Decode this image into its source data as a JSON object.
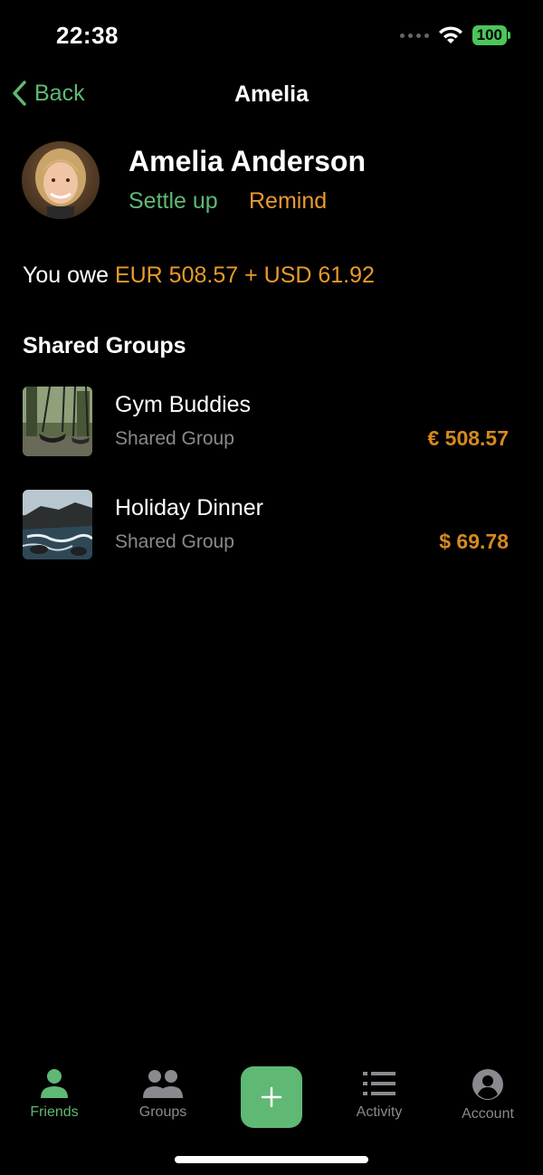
{
  "status_bar": {
    "time": "22:38",
    "battery": "100"
  },
  "nav": {
    "back_label": "Back",
    "title": "Amelia"
  },
  "profile": {
    "name": "Amelia Anderson",
    "settle_label": "Settle up",
    "remind_label": "Remind"
  },
  "balance": {
    "prefix": "You owe",
    "amount": "EUR 508.57 + USD 61.92"
  },
  "shared_groups": {
    "title": "Shared Groups",
    "items": [
      {
        "name": "Gym Buddies",
        "subtitle": "Shared Group",
        "amount": "€ 508.57"
      },
      {
        "name": "Holiday Dinner",
        "subtitle": "Shared Group",
        "amount": "$ 69.78"
      }
    ]
  },
  "tabbar": {
    "items": [
      {
        "label": "Friends",
        "icon": "person-icon",
        "active": true
      },
      {
        "label": "Groups",
        "icon": "people-icon",
        "active": false
      },
      {
        "label": "",
        "icon": "plus-icon",
        "active": false
      },
      {
        "label": "Activity",
        "icon": "list-icon",
        "active": false
      },
      {
        "label": "Account",
        "icon": "account-circle-icon",
        "active": false
      }
    ]
  },
  "colors": {
    "accent_green": "#5fb874",
    "accent_orange": "#e99a2c",
    "background": "#000000",
    "secondary_text": "#8a8a8e"
  }
}
